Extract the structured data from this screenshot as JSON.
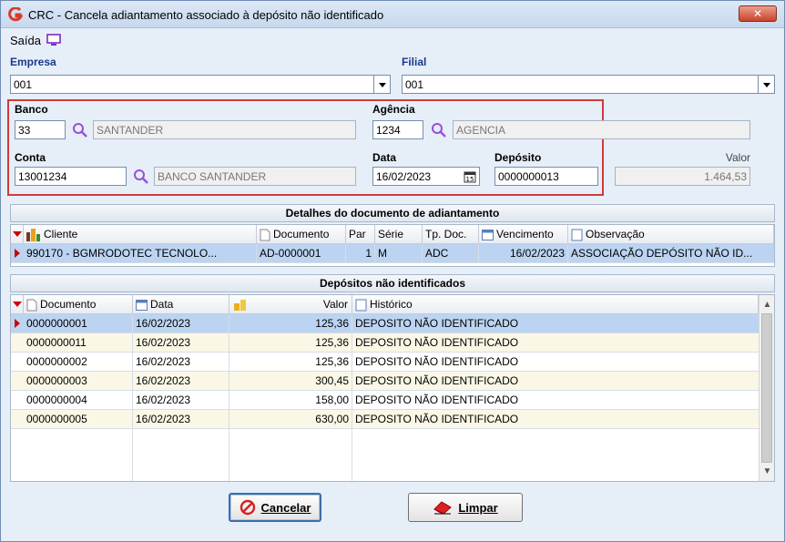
{
  "window": {
    "title": "CRC - Cancela adiantamento associado à depósito não identificado",
    "close_label": "✕"
  },
  "menu": {
    "saida": "Saída"
  },
  "empresa": {
    "label": "Empresa",
    "value": "001"
  },
  "filial": {
    "label": "Filial",
    "value": "001"
  },
  "banco": {
    "label": "Banco",
    "code": "33",
    "name": "SANTANDER"
  },
  "agencia": {
    "label": "Agência",
    "code": "1234",
    "name": "AGENCIA"
  },
  "conta": {
    "label": "Conta",
    "code": "13001234",
    "name": "BANCO SANTANDER"
  },
  "data": {
    "label": "Data",
    "value": "16/02/2023"
  },
  "deposito": {
    "label": "Depósito",
    "value": "0000000013"
  },
  "valor": {
    "label": "Valor",
    "value": "1.464,53"
  },
  "detalhes": {
    "title": "Detalhes do documento de adiantamento",
    "columns": [
      "Cliente",
      "Documento",
      "Par",
      "Série",
      "Tp. Doc.",
      "Vencimento",
      "Observação"
    ],
    "row": {
      "cliente": "990170 - BGMRODOTEC TECNOLO...",
      "documento": "AD-0000001",
      "par": "1",
      "serie": "M",
      "tpdoc": "ADC",
      "vencimento": "16/02/2023",
      "observacao": "ASSOCIAÇÃO DEPÓSITO NÃO ID..."
    }
  },
  "depositos": {
    "title": "Depósitos não identificados",
    "columns": [
      "Documento",
      "Data",
      "Valor",
      "Histórico"
    ],
    "rows": [
      {
        "documento": "0000000001",
        "data": "16/02/2023",
        "valor": "125,36",
        "historico": "DEPOSITO NÃO IDENTIFICADO"
      },
      {
        "documento": "0000000011",
        "data": "16/02/2023",
        "valor": "125,36",
        "historico": "DEPOSITO NÃO IDENTIFICADO"
      },
      {
        "documento": "0000000002",
        "data": "16/02/2023",
        "valor": "125,36",
        "historico": "DEPOSITO NÃO IDENTIFICADO"
      },
      {
        "documento": "0000000003",
        "data": "16/02/2023",
        "valor": "300,45",
        "historico": "DEPOSITO NÃO IDENTIFICADO"
      },
      {
        "documento": "0000000004",
        "data": "16/02/2023",
        "valor": "158,00",
        "historico": "DEPOSITO NÃO IDENTIFICADO"
      },
      {
        "documento": "0000000005",
        "data": "16/02/2023",
        "valor": "630,00",
        "historico": "DEPOSITO NÃO IDENTIFICADO"
      }
    ]
  },
  "buttons": {
    "cancelar": "Cancelar",
    "limpar": "Limpar"
  },
  "colors": {
    "highlight_border": "#d23a3a",
    "selected_row": "#bcd4f2",
    "alt_row": "#fbf7e6",
    "label_blue": "#1a3a8a"
  }
}
